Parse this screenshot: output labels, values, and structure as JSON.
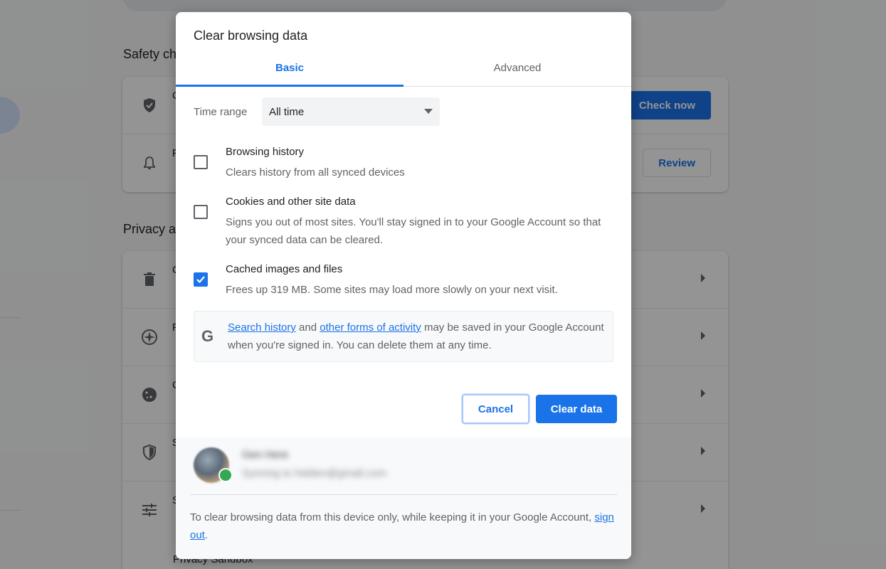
{
  "background": {
    "sections": {
      "safety_check_title": "Safety ch",
      "privacy_title": "Privacy a"
    },
    "safety_rows": [
      {
        "icon": "shield-check-icon",
        "label": "C",
        "button": "Check now"
      },
      {
        "icon": "bell-icon",
        "label": "F",
        "button": "Review"
      }
    ],
    "privacy_rows": [
      {
        "icon": "trash-icon",
        "label": "C"
      },
      {
        "icon": "compass-icon",
        "label": "F"
      },
      {
        "icon": "cookie-icon",
        "label": "C"
      },
      {
        "icon": "security-shield-icon",
        "label": "S"
      },
      {
        "icon": "sliders-icon",
        "label": "S"
      }
    ],
    "last_row_label": "Privacy Sandbox"
  },
  "dialog": {
    "title": "Clear browsing data",
    "tabs": [
      {
        "label": "Basic",
        "active": true
      },
      {
        "label": "Advanced",
        "active": false
      }
    ],
    "time_range": {
      "label": "Time range",
      "value": "All time"
    },
    "options": [
      {
        "title": "Browsing history",
        "description": "Clears history from all synced devices",
        "checked": false
      },
      {
        "title": "Cookies and other site data",
        "description": "Signs you out of most sites. You'll stay signed in to your Google Account so that your synced data can be cleared.",
        "checked": false
      },
      {
        "title": "Cached images and files",
        "description": "Frees up 319 MB. Some sites may load more slowly on your next visit.",
        "checked": true
      }
    ],
    "google_info": {
      "icon": "G",
      "link1": "Search history",
      "and": " and ",
      "link2": "other forms of activity",
      "rest": " may be saved in your Google Account when you're signed in. You can delete them at any time."
    },
    "buttons": {
      "cancel": "Cancel",
      "clear": "Clear data"
    },
    "account": {
      "name": "Gen Here",
      "email": "Syncing to hidden@gmail.com",
      "signout_prefix": "To clear browsing data from this device only, while keeping it in your Google Account, ",
      "signout_link": "sign out",
      "signout_suffix": "."
    }
  },
  "colors": {
    "accent": "#1a73e8",
    "text_primary": "#202124",
    "text_secondary": "#5f6368",
    "sync_badge": "#34a853"
  }
}
